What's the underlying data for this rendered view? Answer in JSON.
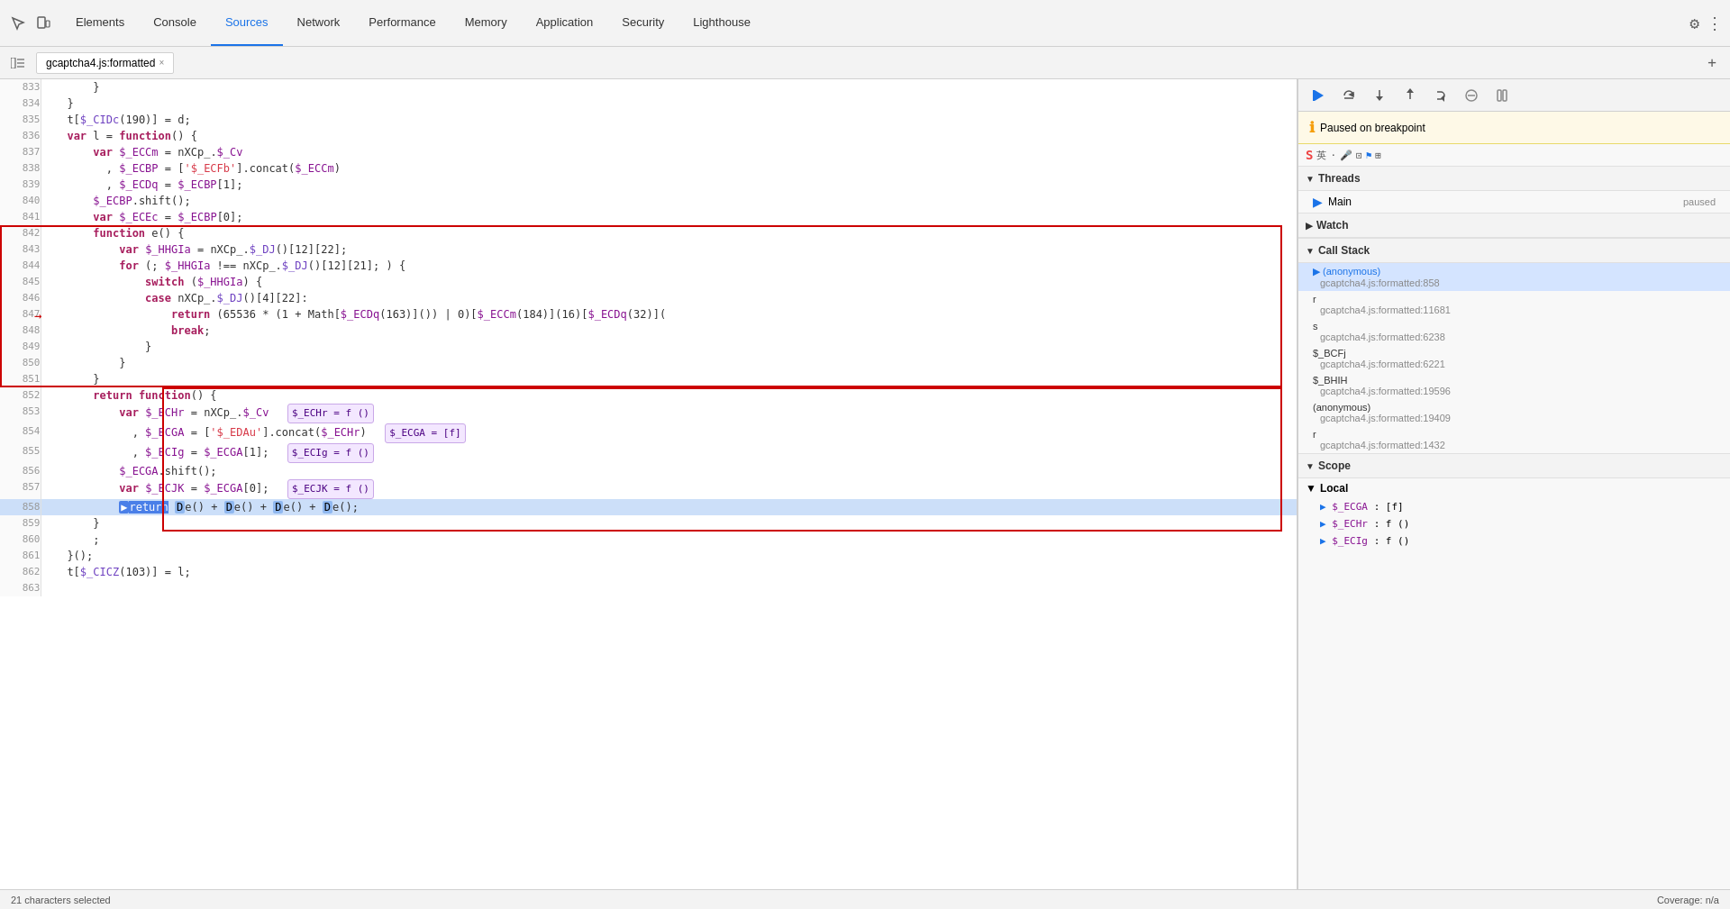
{
  "tabs": [
    {
      "label": "Elements",
      "active": false
    },
    {
      "label": "Console",
      "active": false
    },
    {
      "label": "Sources",
      "active": true
    },
    {
      "label": "Network",
      "active": false
    },
    {
      "label": "Performance",
      "active": false
    },
    {
      "label": "Memory",
      "active": false
    },
    {
      "label": "Application",
      "active": false
    },
    {
      "label": "Security",
      "active": false
    },
    {
      "label": "Lighthouse",
      "active": false
    }
  ],
  "file_tab": {
    "name": "gcaptcha4.js:formatted",
    "close": "×"
  },
  "paused_banner": "Paused on breakpoint",
  "threads": {
    "header": "Threads",
    "items": [
      {
        "name": "Main",
        "status": "paused"
      }
    ]
  },
  "watch": {
    "header": "Watch"
  },
  "callstack": {
    "header": "Call Stack",
    "items": [
      {
        "func": "(anonymous)",
        "loc": "gcaptcha4.js:formatted:858",
        "active": true
      },
      {
        "func": "r",
        "loc": "gcaptcha4.js:formatted:11681",
        "active": false
      },
      {
        "func": "s",
        "loc": "gcaptcha4.js:formatted:6238",
        "active": false
      },
      {
        "func": "$_BCFj",
        "loc": "gcaptcha4.js:formatted:6221",
        "active": false
      },
      {
        "func": "$_BHIH",
        "loc": "gcaptcha4.js:formatted:19596",
        "active": false
      },
      {
        "func": "(anonymous)",
        "loc": "gcaptcha4.js:formatted:19409",
        "active": false
      },
      {
        "func": "r",
        "loc": "gcaptcha4.js:formatted:1432",
        "active": false
      }
    ]
  },
  "scope": {
    "header": "Scope",
    "local": {
      "header": "Local",
      "vars": [
        {
          "name": "$_ECGA",
          "val": ": [f]"
        },
        {
          "name": "$_ECHr",
          "val": ": f ()"
        },
        {
          "name": "$_ECIg",
          "val": ": f ()"
        }
      ]
    }
  },
  "status_bar": {
    "left": "21 characters selected",
    "right": "Coverage: n/a"
  },
  "code_lines": [
    {
      "num": 833,
      "content": "        }"
    },
    {
      "num": 834,
      "content": "    }"
    },
    {
      "num": 835,
      "content": "    t[$_CIDc(190)] = d;"
    },
    {
      "num": 836,
      "content": "    var l = function() {"
    },
    {
      "num": 837,
      "content": "        var $_ECCm = nXCp_.$_Cv"
    },
    {
      "num": 838,
      "content": "          , $_ECBP = ['$_ECFb'].concat($_ECCm)"
    },
    {
      "num": 839,
      "content": "          , $_ECDq = $_ECBP[1];"
    },
    {
      "num": 840,
      "content": "        $_ECBP.shift();"
    },
    {
      "num": 841,
      "content": "        var $_ECEc = $_ECBP[0];"
    },
    {
      "num": 842,
      "content": "        function e() {"
    },
    {
      "num": 843,
      "content": "            var $_HHGIa = nXCp_.$_DJ()[12][22];"
    },
    {
      "num": 844,
      "content": "            for (; $_HHGIa !== nXCp_.$_DJ()[12][21]; ) {"
    },
    {
      "num": 845,
      "content": "                switch ($_HHGIa) {"
    },
    {
      "num": 846,
      "content": "                case nXCp_.$_DJ()[4][22]:"
    },
    {
      "num": 847,
      "content": "                    return (65536 * (1 + Math[$_ECDq(163)]()) | 0)[$_ECCm(184)](16)[$_ECDq(32)]("
    },
    {
      "num": 848,
      "content": "                    break;"
    },
    {
      "num": 849,
      "content": "                }"
    },
    {
      "num": 850,
      "content": "            }"
    },
    {
      "num": 851,
      "content": "        }"
    },
    {
      "num": 852,
      "content": "        return function() {"
    },
    {
      "num": 853,
      "content": "            var $_ECHr = nXCp_.$_Cv"
    },
    {
      "num": 854,
      "content": "              , $_ECGA = ['$_EDAu'].concat($_ECHr)"
    },
    {
      "num": 855,
      "content": "              , $_ECIg = $_ECGA[1];"
    },
    {
      "num": 856,
      "content": "            $_ECGA.shift();"
    },
    {
      "num": 857,
      "content": "            var $_ECJK = $_ECGA[0];"
    },
    {
      "num": 858,
      "content": "            return De() + De() + De() + De();",
      "active": true
    },
    {
      "num": 859,
      "content": "        }"
    },
    {
      "num": 860,
      "content": "        ;"
    },
    {
      "num": 861,
      "content": "    }();"
    },
    {
      "num": 862,
      "content": "    t[$_CICZ(103)] = l;"
    },
    {
      "num": 863,
      "content": ""
    }
  ]
}
